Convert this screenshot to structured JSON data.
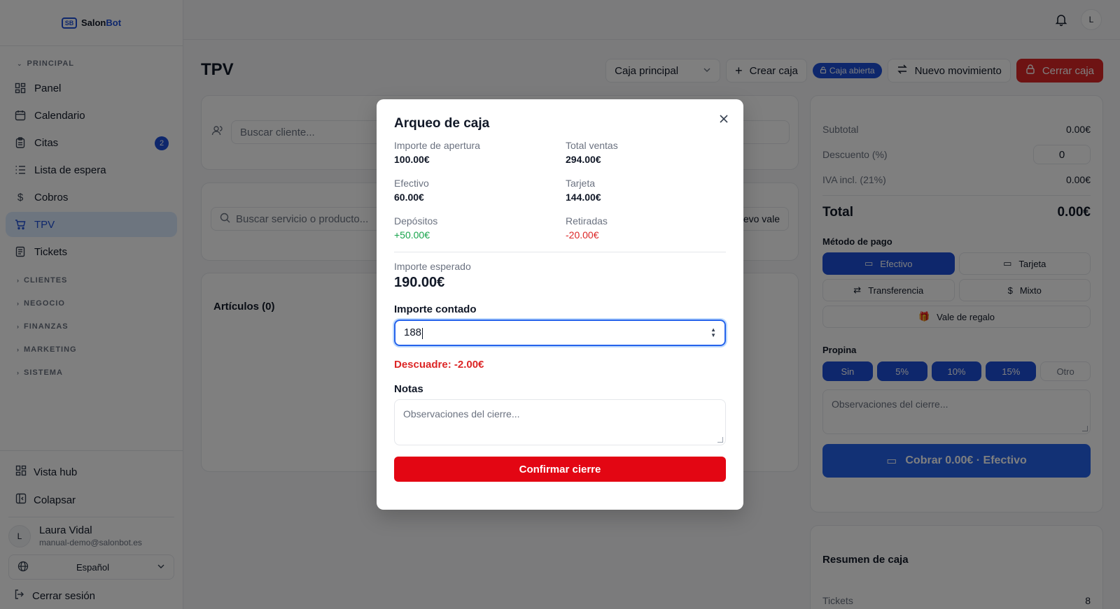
{
  "brand": {
    "prefix": "Salon",
    "accent_part": "Bot",
    "mark": "SB"
  },
  "sidebar": {
    "section_principal": "PRINCIPAL",
    "items": [
      {
        "label": "Panel",
        "icon": "grid-icon"
      },
      {
        "label": "Calendario",
        "icon": "calendar-icon"
      },
      {
        "label": "Citas",
        "icon": "clipboard-icon",
        "badge": "2"
      },
      {
        "label": "Lista de espera",
        "icon": "list-icon"
      },
      {
        "label": "Cobros",
        "icon": "dollar-icon"
      },
      {
        "label": "TPV",
        "icon": "cart-icon",
        "active": true
      },
      {
        "label": "Tickets",
        "icon": "receipt-icon"
      }
    ],
    "groups": [
      "CLIENTES",
      "NEGOCIO",
      "FINANZAS",
      "MARKETING",
      "SISTEMA"
    ],
    "hub_label": "Vista hub",
    "collapse_label": "Colapsar",
    "user": {
      "initial": "L",
      "name": "Laura Vidal",
      "email": "manual-demo@salonbot.es"
    },
    "language": "Español",
    "logout": "Cerrar sesión"
  },
  "topbar": {
    "user_initial": "L"
  },
  "page": {
    "title": "TPV",
    "caja_select": "Caja principal",
    "create_caja": "Crear caja",
    "status_pill": "Caja abierta",
    "new_movement": "Nuevo movimiento",
    "close_caja": "Cerrar caja"
  },
  "main": {
    "client_search_placeholder": "Buscar cliente...",
    "service_search_placeholder": "Buscar servicio o producto...",
    "new_voucher_partial": "evo vale",
    "items_title": "Artículos (0)"
  },
  "summary": {
    "subtotal_label": "Subtotal",
    "subtotal": "0.00€",
    "discount_label": "Descuento (%)",
    "discount": "0",
    "vat_label": "IVA incl. (21%)",
    "vat": "0.00€",
    "total_label": "Total",
    "total": "0.00€",
    "payment_title": "Método de pago",
    "payment_methods": [
      "Efectivo",
      "Tarjeta",
      "Transferencia",
      "Mixto",
      "Vale de regalo"
    ],
    "tip_title": "Propina",
    "tips": [
      "Sin",
      "5%",
      "10%",
      "15%",
      "Otro"
    ],
    "notes_placeholder": "Observaciones del cierre...",
    "charge_button": "Cobrar 0.00€ · Efectivo"
  },
  "box_summary": {
    "title": "Resumen de caja",
    "tickets_label": "Tickets",
    "tickets": "8"
  },
  "modal": {
    "title": "Arqueo de caja",
    "stats": [
      {
        "label": "Importe de apertura",
        "value": "100.00€",
        "tone": "normal"
      },
      {
        "label": "Total ventas",
        "value": "294.00€",
        "tone": "normal"
      },
      {
        "label": "Efectivo",
        "value": "60.00€",
        "tone": "normal"
      },
      {
        "label": "Tarjeta",
        "value": "144.00€",
        "tone": "normal"
      },
      {
        "label": "Depósitos",
        "value": "+50.00€",
        "tone": "pos"
      },
      {
        "label": "Retiradas",
        "value": "-20.00€",
        "tone": "neg"
      }
    ],
    "expected_label": "Importe esperado",
    "expected_value": "190.00€",
    "counted_label": "Importe contado",
    "counted_value": "188",
    "discrepancy": "Descuadre: -2.00€",
    "notes_label": "Notas",
    "notes_placeholder": "Observaciones del cierre...",
    "confirm_label": "Confirmar cierre"
  },
  "colors": {
    "primary": "#1d4ed8",
    "danger": "#dc2626",
    "confirm": "#e30613",
    "positive": "#16a34a"
  }
}
